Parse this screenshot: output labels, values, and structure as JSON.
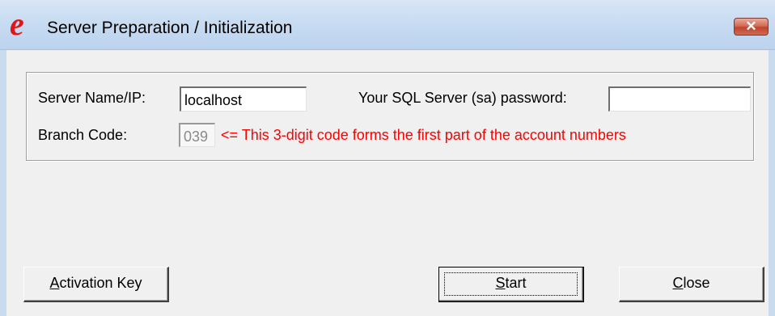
{
  "window": {
    "title": "Server Preparation / Initialization",
    "app_icon_glyph": "e",
    "close_glyph": "✕"
  },
  "form": {
    "server_label": "Server Name/IP:",
    "server_value": "localhost",
    "password_label": "Your SQL Server (sa) password:",
    "password_value": "",
    "branch_label": "Branch Code:",
    "branch_value": "039",
    "branch_hint": "<= This 3-digit code forms the first part of the account numbers"
  },
  "buttons": {
    "activation": "Activation Key",
    "start": "Start",
    "close": "Close"
  },
  "colors": {
    "hint": "#ff0000",
    "app_icon": "#e0161b",
    "close_button": "#c1432c"
  }
}
